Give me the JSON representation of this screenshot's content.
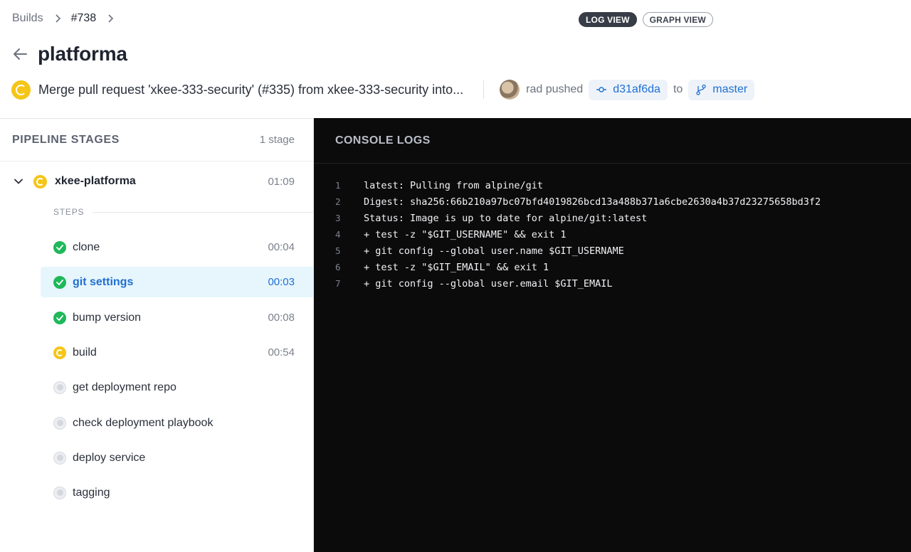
{
  "breadcrumb": {
    "root": "Builds",
    "build": "#738"
  },
  "view_toggle": {
    "log_view": "LOG VIEW",
    "graph_view": "GRAPH VIEW"
  },
  "title": "platforma",
  "commit": {
    "message": "Merge pull request 'xkee-333-security' (#335) from xkee-333-security into...",
    "author_action": "rad pushed",
    "sha": "d31af6da",
    "to": "to",
    "branch": "master"
  },
  "pipeline": {
    "header": "PIPELINE STAGES",
    "count": "1 stage",
    "stage": {
      "name": "xkee-platforma",
      "duration": "01:09",
      "status": "running"
    },
    "steps_label": "STEPS",
    "steps": [
      {
        "name": "clone",
        "duration": "00:04",
        "status": "success"
      },
      {
        "name": "git settings",
        "duration": "00:03",
        "status": "success",
        "selected": true
      },
      {
        "name": "bump version",
        "duration": "00:08",
        "status": "success"
      },
      {
        "name": "build",
        "duration": "00:54",
        "status": "running"
      },
      {
        "name": "get deployment repo",
        "duration": "",
        "status": "pending"
      },
      {
        "name": "check deployment playbook",
        "duration": "",
        "status": "pending"
      },
      {
        "name": "deploy service",
        "duration": "",
        "status": "pending"
      },
      {
        "name": "tagging",
        "duration": "",
        "status": "pending"
      }
    ]
  },
  "console": {
    "title": "CONSOLE LOGS",
    "lines": [
      {
        "n": "1",
        "text": "latest: Pulling from alpine/git"
      },
      {
        "n": "2",
        "text": "Digest: sha256:66b210a97bc07bfd4019826bcd13a488b371a6cbe2630a4b37d23275658bd3f2"
      },
      {
        "n": "3",
        "text": "Status: Image is up to date for alpine/git:latest"
      },
      {
        "n": "4",
        "text": "+ test -z \"$GIT_USERNAME\" && exit 1"
      },
      {
        "n": "5",
        "text": "+ git config --global user.name $GIT_USERNAME"
      },
      {
        "n": "6",
        "text": "+ test -z \"$GIT_EMAIL\" && exit 1"
      },
      {
        "n": "7",
        "text": "+ git config --global user.email $GIT_EMAIL"
      }
    ]
  },
  "colors": {
    "accent": "#1f6fd1",
    "running": "#f5c518",
    "success": "#1fb85a",
    "console_bg": "#0b0b0c",
    "selected_bg": "#e7f6fd"
  }
}
